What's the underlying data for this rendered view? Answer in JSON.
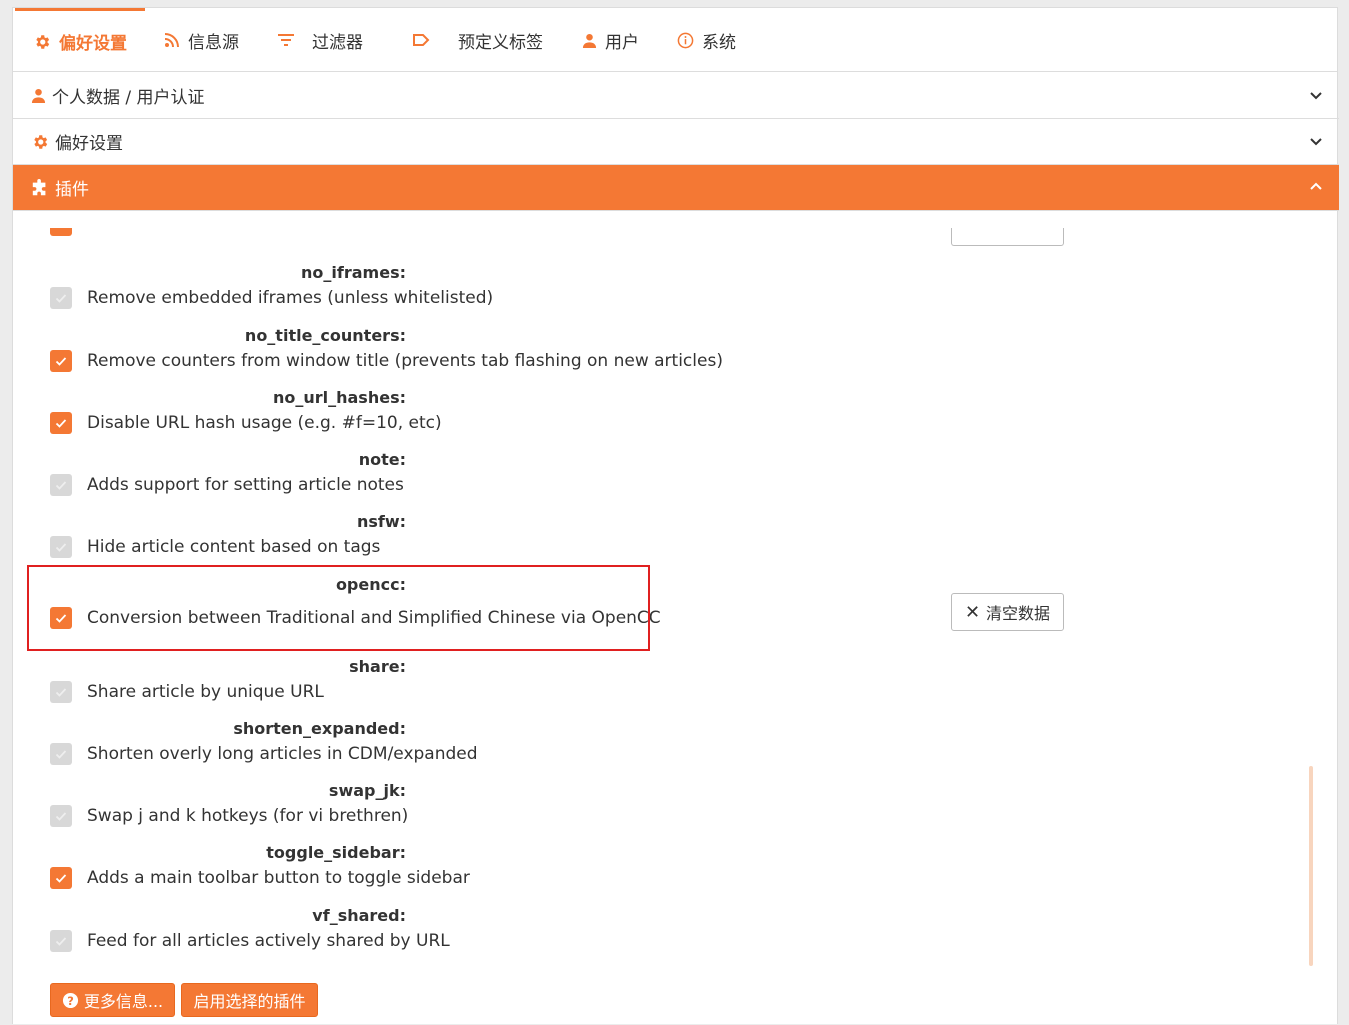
{
  "tabs": [
    {
      "label": "偏好设置",
      "icon": "gear-icon",
      "active": true
    },
    {
      "label": "信息源",
      "icon": "rss-icon"
    },
    {
      "label": "过滤器",
      "icon": "filter-icon"
    },
    {
      "label": "预定义标签",
      "icon": "label-icon"
    },
    {
      "label": "用户",
      "icon": "user-icon"
    },
    {
      "label": "系统",
      "icon": "info-icon"
    }
  ],
  "accordions": [
    {
      "label": "个人数据 / 用户认证",
      "icon": "user-icon",
      "expanded": false
    },
    {
      "label": "偏好设置",
      "icon": "gear-icon",
      "expanded": false
    },
    {
      "label": "插件",
      "icon": "puzzle-icon",
      "expanded": true
    }
  ],
  "plugins": [
    {
      "name": "no_iframes:",
      "desc": "Remove embedded iframes (unless whitelisted)",
      "checked": false,
      "disabled": true
    },
    {
      "name": "no_title_counters:",
      "desc": "Remove counters from window title (prevents tab flashing on new articles)",
      "checked": true
    },
    {
      "name": "no_url_hashes:",
      "desc": "Disable URL hash usage (e.g. #f=10, etc)",
      "checked": true
    },
    {
      "name": "note:",
      "desc": "Adds support for setting article notes",
      "checked": false,
      "disabled": true
    },
    {
      "name": "nsfw:",
      "desc": "Hide article content based on tags",
      "checked": false,
      "disabled": true
    },
    {
      "name": "opencc:",
      "desc": "Conversion between Traditional and Simplified Chinese via OpenCC",
      "checked": true
    },
    {
      "name": "share:",
      "desc": "Share article by unique URL",
      "checked": false,
      "disabled": true
    },
    {
      "name": "shorten_expanded:",
      "desc": "Shorten overly long articles in CDM/expanded",
      "checked": false,
      "disabled": true
    },
    {
      "name": "swap_jk:",
      "desc": "Swap j and k hotkeys (for vi brethren)",
      "checked": false,
      "disabled": true
    },
    {
      "name": "toggle_sidebar:",
      "desc": "Adds a main toolbar button to toggle sidebar",
      "checked": true
    },
    {
      "name": "vf_shared:",
      "desc": "Feed for all articles actively shared by URL",
      "checked": false,
      "disabled": true
    }
  ],
  "clear_data_label": "清空数据",
  "buttons": {
    "more_info": "更多信息...",
    "enable_selected": "启用选择的插件"
  },
  "colors": {
    "accent": "#f47834",
    "highlight": "#e02020"
  }
}
